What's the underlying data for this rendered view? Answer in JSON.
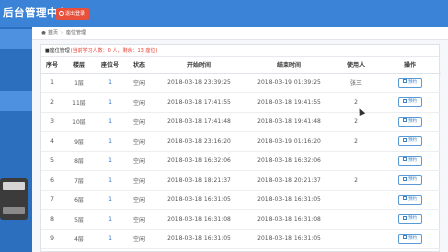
{
  "header": {
    "title": "后台管理中心",
    "logout_label": "退出登录"
  },
  "sidebar": {
    "items": [
      "",
      "",
      "",
      "",
      "",
      "",
      ""
    ]
  },
  "breadcrumb": {
    "home": "首页",
    "current": "座位管理"
  },
  "panel": {
    "title": "■座位管理",
    "summary": "(当前学习人数：0 人，剩余：13 座位)"
  },
  "table": {
    "headers": [
      "序号",
      "楼层",
      "座位号",
      "状态",
      "开始时间",
      "结束时间",
      "使用人",
      "操作"
    ],
    "rows": [
      {
        "no": "1",
        "floor": "1层",
        "seat": "1",
        "status": "空闲",
        "start": "2018-03-18 23:39:25",
        "end": "2018-03-19 01:39:25",
        "user": "张三",
        "action": "预约"
      },
      {
        "no": "2",
        "floor": "11层",
        "seat": "1",
        "status": "空闲",
        "start": "2018-03-18 17:41:55",
        "end": "2018-03-18 19:41:55",
        "user": "2",
        "action": "预约"
      },
      {
        "no": "3",
        "floor": "10层",
        "seat": "1",
        "status": "空闲",
        "start": "2018-03-18 17:41:48",
        "end": "2018-03-18 19:41:48",
        "user": "2",
        "action": "预约"
      },
      {
        "no": "4",
        "floor": "9层",
        "seat": "1",
        "status": "空闲",
        "start": "2018-03-18 23:16:20",
        "end": "2018-03-19 01:16:20",
        "user": "2",
        "action": "预约"
      },
      {
        "no": "5",
        "floor": "8层",
        "seat": "1",
        "status": "空闲",
        "start": "2018-03-18 16:32:06",
        "end": "2018-03-18 16:32:06",
        "user": "",
        "action": "预约"
      },
      {
        "no": "6",
        "floor": "7层",
        "seat": "1",
        "status": "空闲",
        "start": "2018-03-18 18:21:37",
        "end": "2018-03-18 20:21:37",
        "user": "2",
        "action": "预约"
      },
      {
        "no": "7",
        "floor": "6层",
        "seat": "1",
        "status": "空闲",
        "start": "2018-03-18 16:31:05",
        "end": "2018-03-18 16:31:05",
        "user": "",
        "action": "预约"
      },
      {
        "no": "8",
        "floor": "5层",
        "seat": "1",
        "status": "空闲",
        "start": "2018-03-18 16:31:08",
        "end": "2018-03-18 16:31:08",
        "user": "",
        "action": "预约"
      },
      {
        "no": "9",
        "floor": "4层",
        "seat": "1",
        "status": "空闲",
        "start": "2018-03-18 16:31:05",
        "end": "2018-03-18 16:31:05",
        "user": "",
        "action": "预约"
      }
    ]
  },
  "colors": {
    "header_bg": "#3a83d6",
    "sidebar_bg": "#2d6fbf",
    "logout_bg": "#e8503c",
    "summary_text": "#e83c2e",
    "link_blue": "#2a6fc9"
  }
}
